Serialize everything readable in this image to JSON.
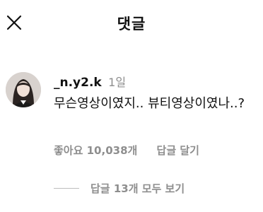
{
  "header": {
    "title": "댓글",
    "close_icon": "close-icon"
  },
  "comment": {
    "avatar_icon": "user-avatar",
    "username": "_n.y2.k",
    "time": "1일",
    "text": "무슨영상이였지.. 뷰티영상이였나..?",
    "likes": "좋아요 10,038개",
    "reply_label": "답글 달기",
    "view_replies": "답글 13개 모두 보기"
  }
}
